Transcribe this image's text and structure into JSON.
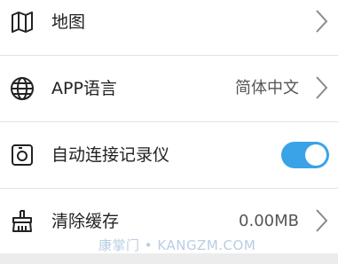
{
  "settings": {
    "items": [
      {
        "label": "地图",
        "icon": "map-icon"
      },
      {
        "label": "APP语言",
        "value": "简体中文",
        "icon": "globe-icon"
      },
      {
        "label": "自动连接记录仪",
        "icon": "camera-icon",
        "toggle_on": true
      },
      {
        "label": "清除缓存",
        "value": "0.00MB",
        "icon": "broom-icon"
      }
    ]
  },
  "watermark": "康掌门 • KANGZM.COM",
  "colors": {
    "toggle_on": "#3aa3e8",
    "icon": "#222222",
    "chevron": "#8a8a8a",
    "divider": "#e2e2e2",
    "page_bg": "#ececec"
  }
}
